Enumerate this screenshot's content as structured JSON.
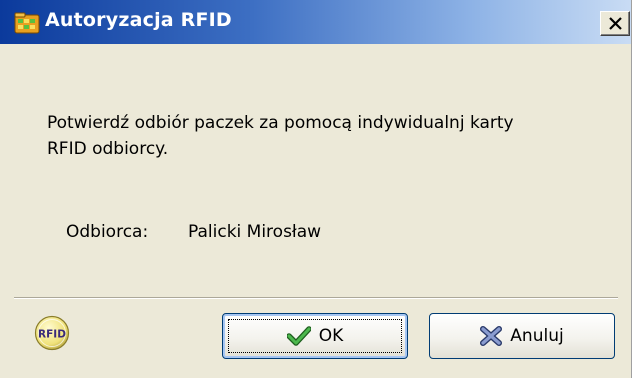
{
  "window": {
    "title": "Autoryzacja RFID",
    "close_label": "close",
    "icon": "folder-grid-icon"
  },
  "dialog": {
    "message_line1": "Potwierdź odbiór paczek za pomocą indywidualnj karty",
    "message_line2": "RFID odbiorcy.",
    "recipient_label": "Odbiorca:",
    "recipient_value": "Palicki Mirosław"
  },
  "footer": {
    "badge_text": "RFID",
    "ok_label": "OK",
    "ok_icon": "checkmark-icon",
    "cancel_label": "Anuluj",
    "cancel_icon": "cross-icon"
  },
  "colors": {
    "titlebar_start": "#0b3a9c",
    "titlebar_end": "#c9dcf4",
    "dialog_bg": "#ece9d8",
    "ok_check": "#2e8b2e",
    "cancel_cross": "#5a6c99"
  }
}
